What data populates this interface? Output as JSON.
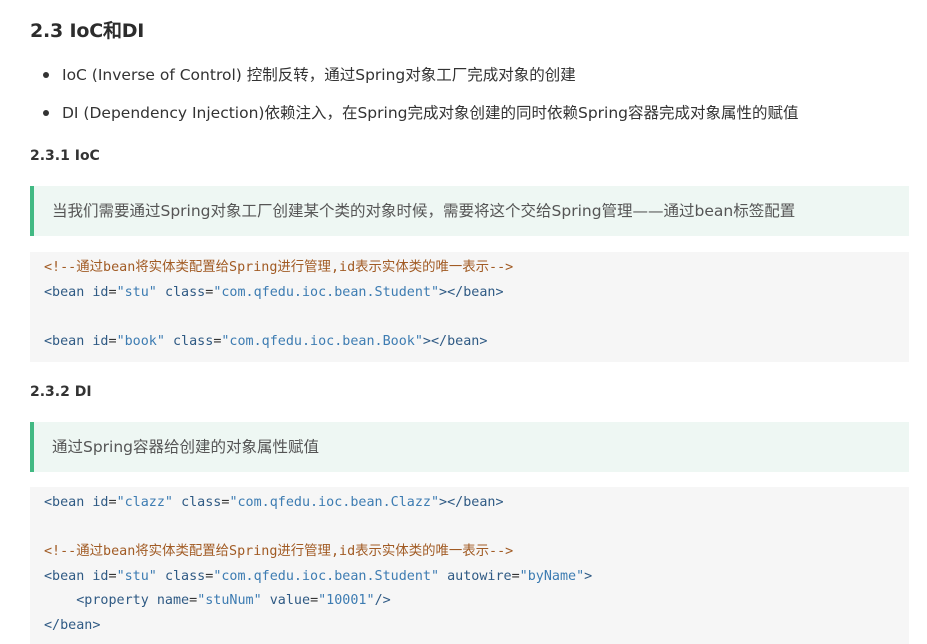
{
  "section": {
    "title": "2.3 IoC和DI",
    "bullets": [
      "IoC (Inverse of Control) 控制反转，通过Spring对象工厂完成对象的创建",
      "DI (Dependency Injection)依赖注入，在Spring完成对象创建的同时依赖Spring容器完成对象属性的赋值"
    ]
  },
  "ioc": {
    "heading": "2.3.1 IoC",
    "quote": "当我们需要通过Spring对象工厂创建某个类的对象时候，需要将这个交给Spring管理——通过bean标签配置",
    "code": {
      "comment": "<!--通过bean将实体类配置给Spring进行管理,id表示实体类的唯一表示-->",
      "bean1": {
        "open": "<bean",
        "id_attr": "id",
        "id_val": "\"stu\"",
        "class_attr": "class",
        "class_val": "\"com.qfedu.ioc.bean.Student\"",
        "close": "></bean>"
      },
      "bean2": {
        "open": "<bean",
        "id_attr": "id",
        "id_val": "\"book\"",
        "class_attr": "class",
        "class_val": "\"com.qfedu.ioc.bean.Book\"",
        "close": "></bean>"
      }
    }
  },
  "di": {
    "heading": "2.3.2 DI",
    "quote": "通过Spring容器给创建的对象属性赋值",
    "code": {
      "bean1": {
        "open": "<bean",
        "id_attr": "id",
        "id_val": "\"clazz\"",
        "class_attr": "class",
        "class_val": "\"com.qfedu.ioc.bean.Clazz\"",
        "close": "></bean>"
      },
      "comment": "<!--通过bean将实体类配置给Spring进行管理,id表示实体类的唯一表示-->",
      "bean2": {
        "open": "<bean",
        "id_attr": "id",
        "id_val": "\"stu\"",
        "class_attr": "class",
        "class_val": "\"com.qfedu.ioc.bean.Student\"",
        "autowire_attr": "autowire",
        "autowire_val": "\"byName\"",
        "close": ">"
      },
      "property": {
        "open": "<property",
        "name_attr": "name",
        "name_val": "\"stuNum\"",
        "value_attr": "value",
        "value_val": "\"10001\"",
        "close": "/>"
      },
      "end": "</bean>"
    }
  }
}
